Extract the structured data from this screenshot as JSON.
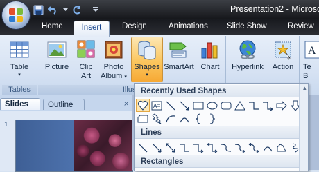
{
  "window": {
    "title": "Presentation2 - Microso"
  },
  "quick_access": {
    "icons": [
      "save-icon",
      "undo-icon",
      "redo-icon",
      "customize-icon"
    ]
  },
  "tabs": [
    "Home",
    "Insert",
    "Design",
    "Animations",
    "Slide Show",
    "Review"
  ],
  "active_tab": "Insert",
  "ribbon": {
    "groups": {
      "tables": "Tables",
      "illustrations": "Illustr"
    },
    "buttons": {
      "table": "Table",
      "picture": "Picture",
      "clip_art_1": "Clip",
      "clip_art_2": "Art",
      "photo_album_1": "Photo",
      "photo_album_2": "Album",
      "shapes": "Shapes",
      "smartart": "SmartArt",
      "chart": "Chart",
      "hyperlink": "Hyperlink",
      "action": "Action",
      "text_box_partial_1": "Te",
      "text_box_partial_2": "B"
    }
  },
  "slides_pane": {
    "tab_slides": "Slides",
    "tab_outline": "Outline",
    "close_glyph": "×",
    "slide_number": "1"
  },
  "shapes_gallery": {
    "recent_header": "Recently Used Shapes",
    "lines_header": "Lines",
    "rectangles_header": "Rectangles"
  },
  "colors": {
    "ribbon_bg": "#d6e2f3",
    "title_bar": "#1e2024",
    "shapes_highlight": "#fbc65e",
    "gallery_bg": "#fafbfd"
  }
}
